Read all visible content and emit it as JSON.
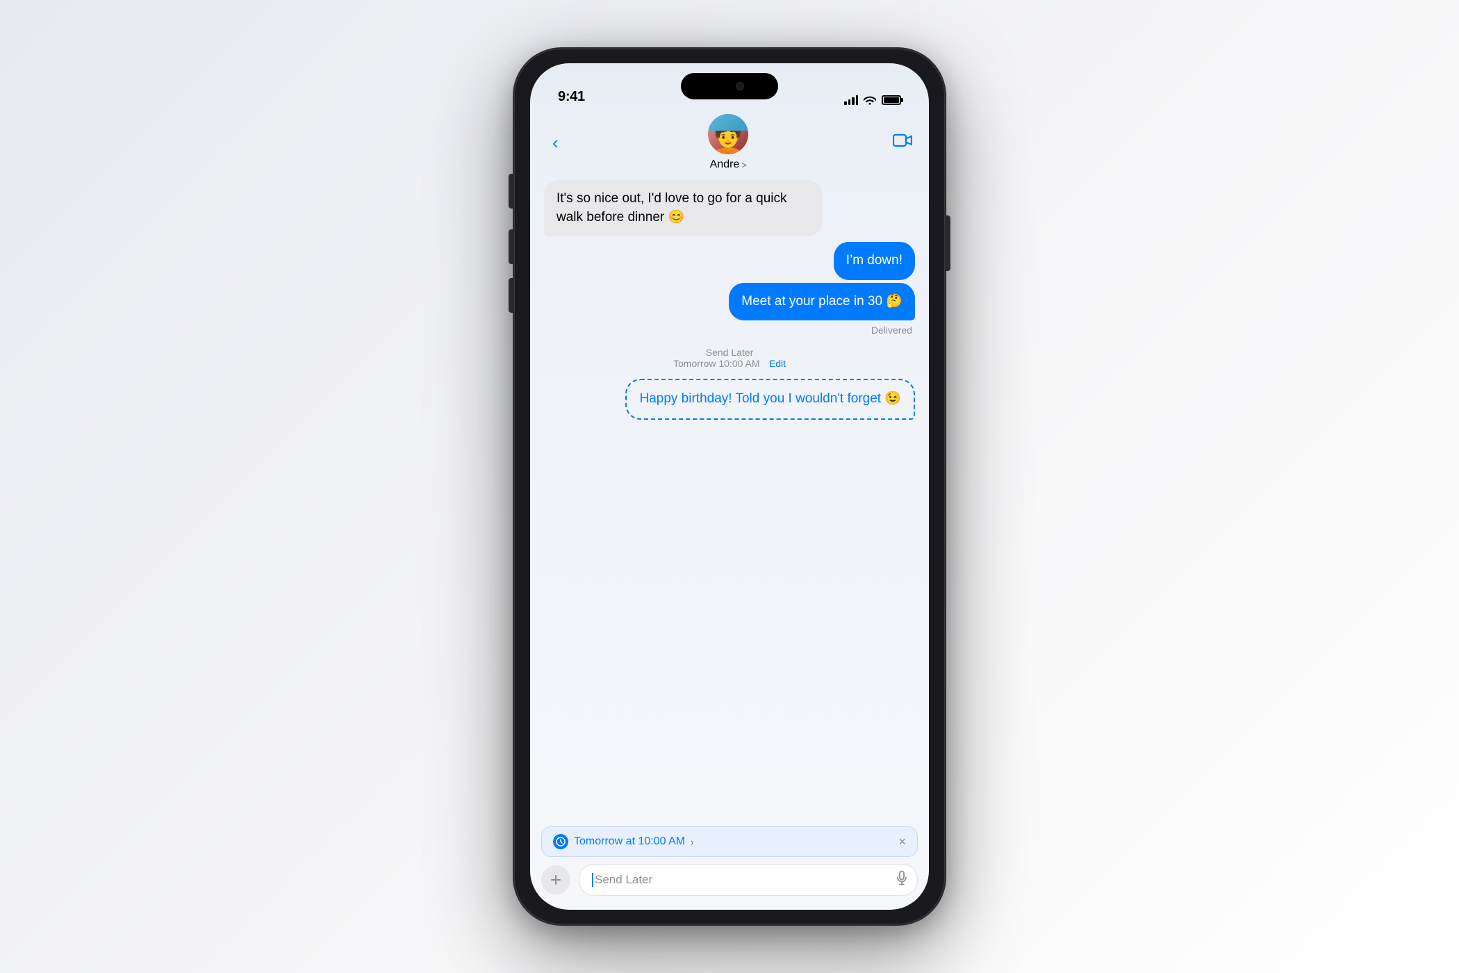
{
  "scene": {
    "background": "#f0f0f0"
  },
  "status_bar": {
    "time": "9:41",
    "signal": "signal-icon",
    "wifi": "wifi-icon",
    "battery": "battery-icon"
  },
  "nav": {
    "back_label": "<",
    "contact_name": "Andre",
    "chevron": ">",
    "video_label": "video-icon"
  },
  "messages": [
    {
      "type": "received",
      "text": "It’s so nice out, I’d love to go for a quick walk before dinner 😊",
      "emoji": "😊"
    },
    {
      "type": "sent",
      "text": "I’m down!",
      "sub": false
    },
    {
      "type": "sent",
      "text": "Meet at your place in 30 🤔",
      "sub": true,
      "delivered": "Delivered"
    }
  ],
  "send_later": {
    "label": "Send Later",
    "time": "Tomorrow 10:00 AM",
    "edit_label": "Edit"
  },
  "scheduled_message": {
    "text": "Happy birthday! Told you I wouldn’t forget 😉",
    "emoji": "😉"
  },
  "bottom": {
    "schedule_time": "Tomorrow at 10:00 AM ›",
    "schedule_time_raw": "Tomorrow at 10:00 AM",
    "input_placeholder": "Send Later",
    "add_button_label": "+",
    "close_label": "×"
  }
}
